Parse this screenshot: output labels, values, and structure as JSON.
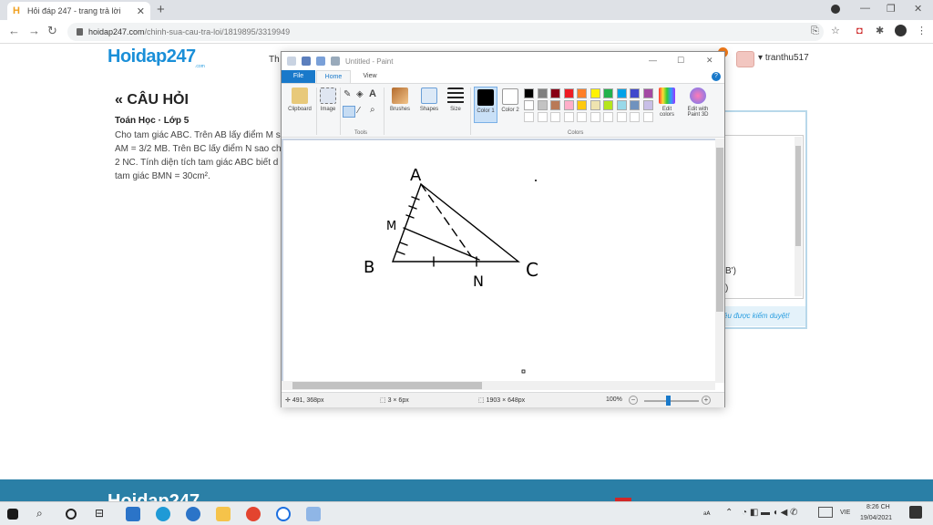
{
  "browser": {
    "tab_title": "Hỏi đáp 247 - trang trả lời",
    "tab_favicon": "H",
    "new_tab_label": "+",
    "url_host": "hoidap247.com",
    "url_path": "/chinh-sua-cau-tra-loi/1819895/3319949"
  },
  "site": {
    "logo": "Hoidap247",
    "logo_sub": ".com",
    "nav_fragment": "Th",
    "username": "tranthu517",
    "question_heading": "« CÂU HỎI",
    "subject": "Toán Học · Lớp 5",
    "question_lines": [
      "Cho tam giác ABC. Trên AB lấy điểm M s",
      "AM = 3/2 MB. Trên BC lấy điểm N sao ch",
      "2 NC. Tính diện tích tam giác ABC biết d",
      "tam giác BMN = 30cm²."
    ],
    "answer_fragment_1": "B')",
    "answer_fragment_2": ")",
    "pending_text": "ều được kiểm duyệt!",
    "footer_logo": "Hoidap247"
  },
  "paint": {
    "title": "Untitled - Paint",
    "tabs": {
      "file": "File",
      "home": "Home",
      "view": "View"
    },
    "help": "?",
    "ribbon": {
      "clipboard": "Clipboard",
      "image": "Image",
      "brushes": "Brushes",
      "shapes": "Shapes",
      "size": "Size",
      "color1": "Color 1",
      "color2": "Color 2",
      "edit_colors": "Edit colors",
      "edit_paint3d": "Edit with Paint 3D",
      "tools_label": "Tools",
      "colors_label": "Colors"
    },
    "palette": [
      "#000000",
      "#7f7f7f",
      "#880015",
      "#ed1c24",
      "#ff7f27",
      "#fff200",
      "#22b14c",
      "#00a2e8",
      "#3f48cc",
      "#a349a4",
      "#ffffff",
      "#c3c3c3",
      "#b97a57",
      "#ffaec9",
      "#ffc90e",
      "#efe4b0",
      "#b5e61d",
      "#99d9ea",
      "#7092be",
      "#c8bfe7"
    ],
    "drawing_labels": {
      "a": "A",
      "m": "M",
      "b": "B",
      "n": "N",
      "c": "C"
    },
    "status": {
      "cursor_pos": "491, 368px",
      "selection_size": "3 × 6px",
      "image_size": "1903 × 648px",
      "zoom": "100%"
    }
  },
  "taskbar": {
    "language": "VIE",
    "time": "8:26 CH",
    "date": "19/04/2021"
  }
}
